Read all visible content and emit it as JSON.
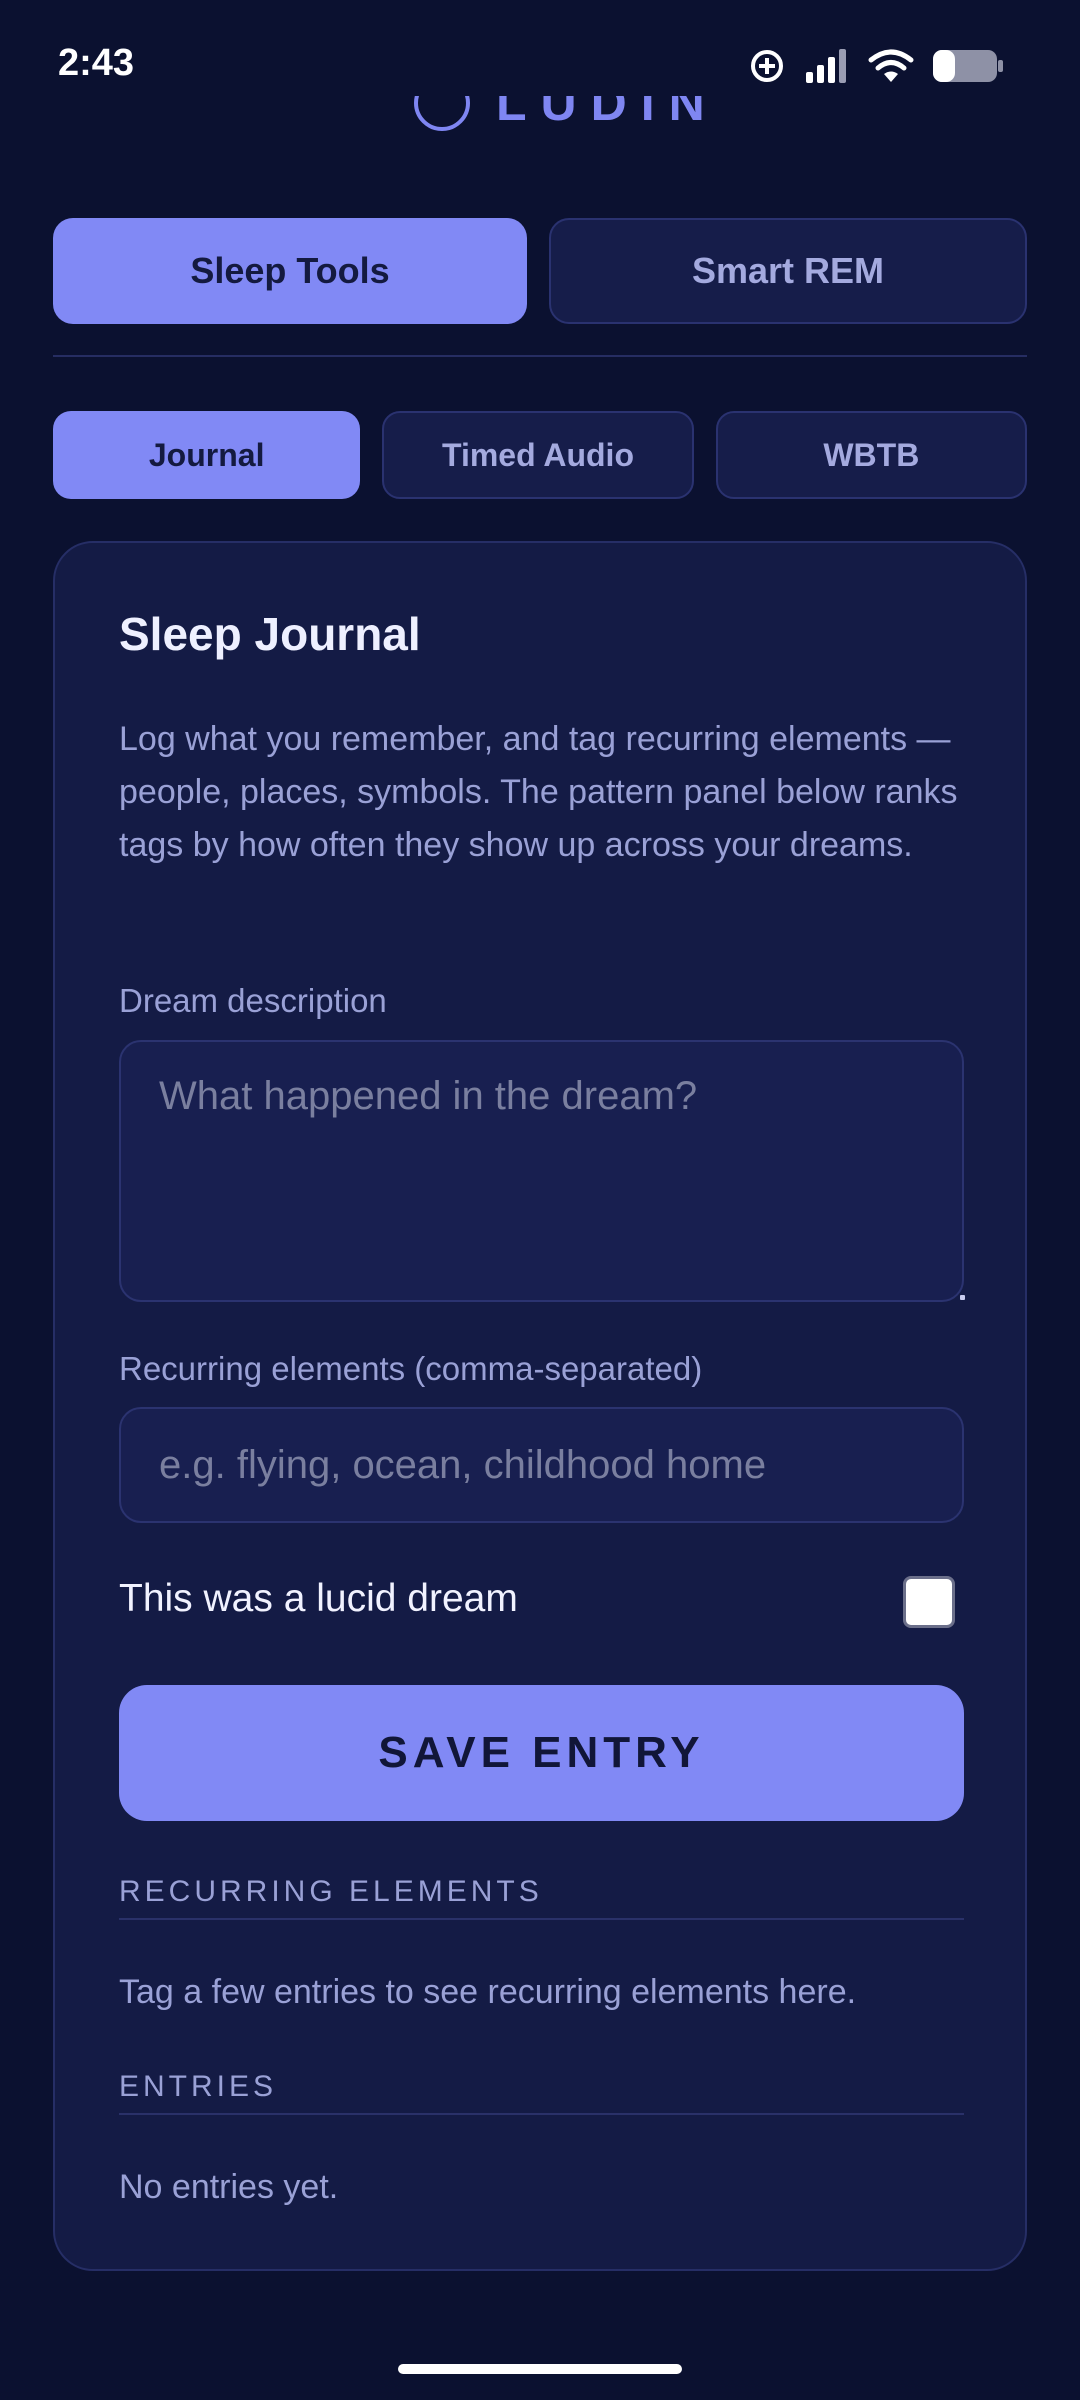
{
  "status_bar": {
    "time": "2:43",
    "icons": [
      "add-circle-icon",
      "cell-signal-icon",
      "wifi-icon",
      "battery-icon"
    ]
  },
  "app": {
    "logo_text": "LUDIN"
  },
  "primary_tabs": [
    {
      "label": "Sleep Tools",
      "active": true
    },
    {
      "label": "Smart REM",
      "active": false
    }
  ],
  "sub_tabs": [
    {
      "label": "Journal",
      "active": true
    },
    {
      "label": "Timed Audio",
      "active": false
    },
    {
      "label": "WBTB",
      "active": false
    }
  ],
  "journal": {
    "title": "Sleep Journal",
    "description": "Log what you remember, and tag recurring elements — people, places, symbols. The pattern panel below ranks tags by how often they show up across your dreams.",
    "dream_label": "Dream description",
    "dream_placeholder": "What happened in the dream?",
    "dream_value": "",
    "tags_label": "Recurring elements (comma-separated)",
    "tags_placeholder": "e.g. flying, ocean, childhood home",
    "tags_value": "",
    "lucid_label": "This was a lucid dream",
    "lucid_checked": false,
    "save_label": "SAVE ENTRY",
    "recurring_heading": "RECURRING ELEMENTS",
    "recurring_empty": "Tag a few entries to see recurring elements here.",
    "entries_heading": "ENTRIES",
    "entries_empty": "No entries yet."
  },
  "colors": {
    "background": "#0b1130",
    "card": "#141b45",
    "accent": "#8189f5",
    "muted_text": "#9aa1d6"
  }
}
